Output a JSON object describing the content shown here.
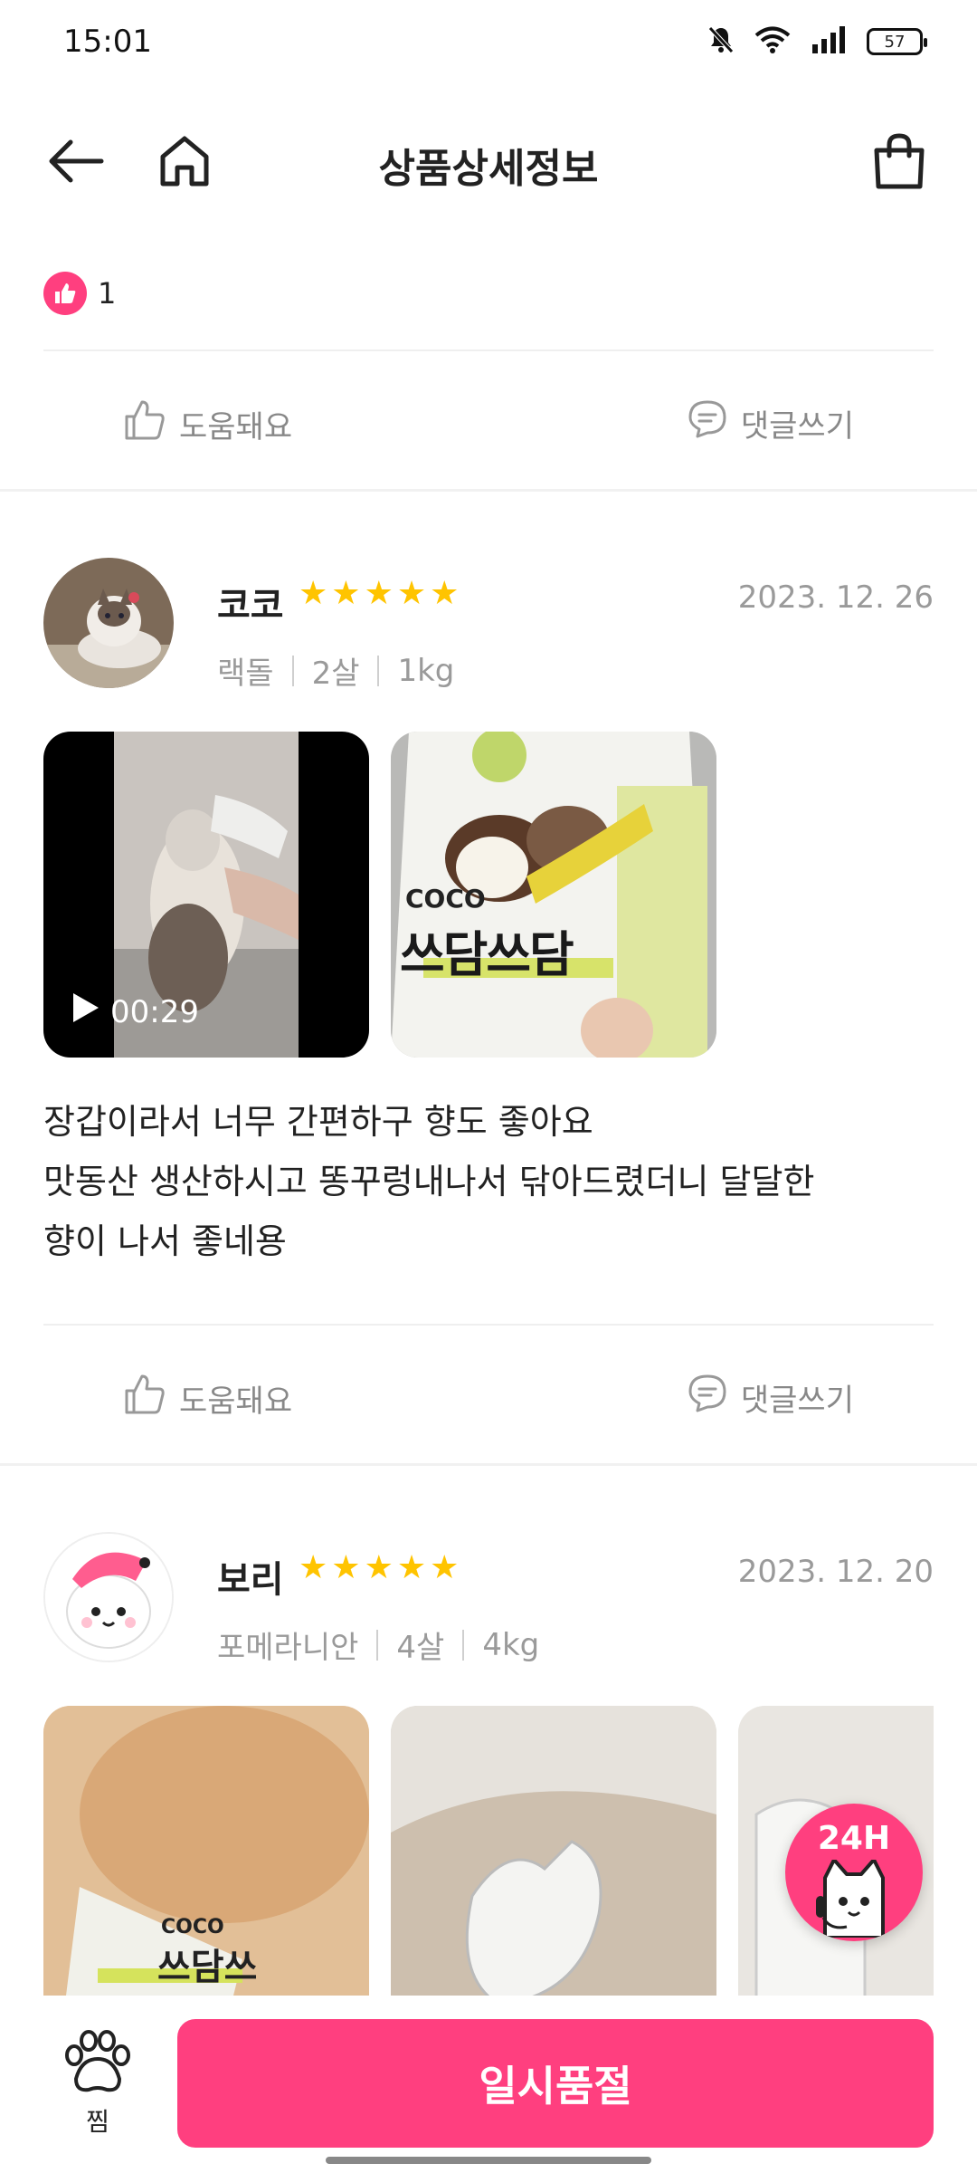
{
  "status_bar": {
    "time": "15:01",
    "battery": "57"
  },
  "header": {
    "title": "상품상세정보"
  },
  "likes": {
    "count": "1"
  },
  "actions": {
    "helpful": "도움돼요",
    "comment": "댓글쓰기"
  },
  "reviews": [
    {
      "name": "코코",
      "date": "2023. 12. 26",
      "breed": "랙돌",
      "age": "2살",
      "weight": "1kg",
      "rating": 5,
      "video_duration": "00:29",
      "product_brand": "COCO",
      "product_name": "쓰담쓰담",
      "text_lines": [
        "장갑이라서 너무 간편하구 향도 좋아요",
        "맛동산 생산하시고 똥꾸렁내나서 닦아드렸더니 달달한",
        "향이 나서 좋네용"
      ]
    },
    {
      "name": "보리",
      "date": "2023. 12. 20",
      "breed": "포메라니안",
      "age": "4살",
      "weight": "4kg",
      "rating": 5,
      "product_brand": "COCO",
      "product_name": "쓰담쓰"
    }
  ],
  "chat": {
    "label": "24H"
  },
  "bottom": {
    "wish_label": "찜",
    "button_label": "일시품절"
  },
  "colors": {
    "accent": "#ff3f7f",
    "star": "#ffc400",
    "muted": "#9a9a9a"
  }
}
